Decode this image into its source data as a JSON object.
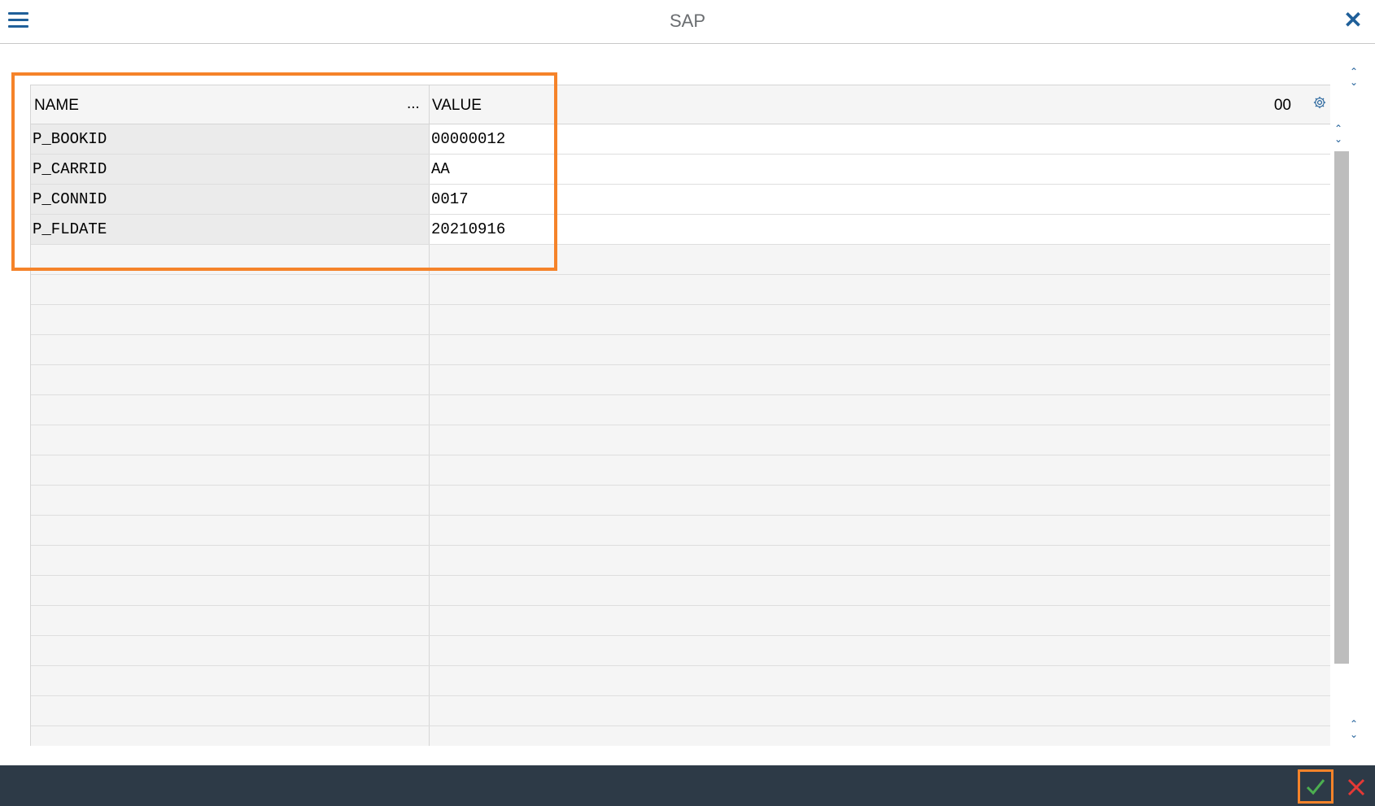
{
  "header": {
    "title": "SAP"
  },
  "grid": {
    "columns": {
      "name": "NAME",
      "more": "...",
      "value": "VALUE"
    },
    "count": "00",
    "rows": [
      {
        "name": "P_BOOKID",
        "value": "00000012"
      },
      {
        "name": "P_CARRID",
        "value": "AA"
      },
      {
        "name": "P_CONNID",
        "value": "0017"
      },
      {
        "name": "P_FLDATE",
        "value": "20210916"
      }
    ]
  },
  "colors": {
    "accent": "#1f5f99",
    "highlight": "#f5832a",
    "footer": "#2d3a47",
    "ok": "#4caf50",
    "cancel": "#e53935"
  },
  "icons": {
    "menu": "hamburger-icon",
    "close": "close-icon",
    "settings": "gear-icon",
    "ok": "checkmark-icon",
    "cancel": "cross-icon"
  }
}
